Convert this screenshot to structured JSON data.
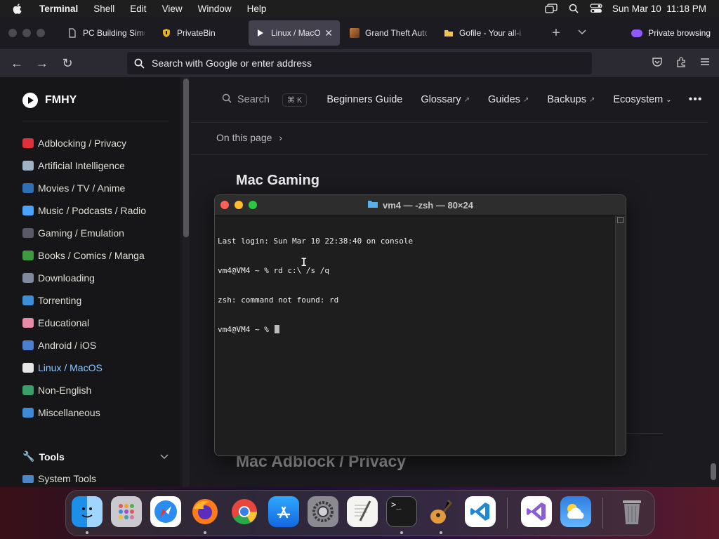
{
  "menubar": {
    "app": "Terminal",
    "items": [
      "Shell",
      "Edit",
      "View",
      "Window",
      "Help"
    ],
    "clock": "Sun Mar 10  11:18 PM"
  },
  "tabs": [
    {
      "label": "PC Building Simu",
      "icon": "document-icon"
    },
    {
      "label": "PrivateBin",
      "icon": "shield-icon"
    },
    {
      "label": "Linux / MacOS",
      "icon": "play-icon",
      "active": true
    },
    {
      "label": "Grand Theft Auto",
      "icon": "game-thumbnail-icon"
    },
    {
      "label": "Gofile - Your all-i",
      "icon": "folder-icon"
    }
  ],
  "private_label": "Private browsing",
  "address_placeholder": "Search with Google or enter address",
  "site": {
    "brand": "FMHY",
    "sidebar": [
      {
        "label": "Adblocking / Privacy",
        "color": "#e0303a"
      },
      {
        "label": "Artificial Intelligence",
        "color": "#9fb3c8"
      },
      {
        "label": "Movies / TV / Anime",
        "color": "#2f6fb5"
      },
      {
        "label": "Music / Podcasts / Radio",
        "color": "#4aa3ff"
      },
      {
        "label": "Gaming / Emulation",
        "color": "#5a5a66"
      },
      {
        "label": "Books / Comics / Manga",
        "color": "#3f9a3f"
      },
      {
        "label": "Downloading",
        "color": "#7f8aa0"
      },
      {
        "label": "Torrenting",
        "color": "#3a8fd8"
      },
      {
        "label": "Educational",
        "color": "#e98aa8"
      },
      {
        "label": "Android / iOS",
        "color": "#4d7fd0"
      },
      {
        "label": "Linux / MacOS",
        "color": "#e6e6e6",
        "active": true
      },
      {
        "label": "Non-English",
        "color": "#3aa06a"
      },
      {
        "label": "Miscellaneous",
        "color": "#3c8ad8"
      }
    ],
    "tools_label": "Tools",
    "tools_sub": "System Tools",
    "search_label": "Search",
    "search_kbd": "⌘ K",
    "nav": [
      {
        "label": "Beginners Guide",
        "ext": false
      },
      {
        "label": "Glossary",
        "ext": true
      },
      {
        "label": "Guides",
        "ext": true
      },
      {
        "label": "Backups",
        "ext": true
      },
      {
        "label": "Ecosystem",
        "ext": false,
        "dropdown": true
      }
    ],
    "on_this_page": "On this page",
    "heading_mac_gaming": "Mac Gaming",
    "heading_mac_adblock": "Mac Adblock / Privacy"
  },
  "terminal": {
    "title": "vm4 — -zsh — 80×24",
    "lines": [
      "Last login: Sun Mar 10 22:38:40 on console",
      "vm4@VM4 ~ % rd c:\\ /s /q",
      "zsh: command not found: rd",
      "vm4@VM4 ~ % "
    ]
  },
  "dock": [
    "Finder",
    "Launchpad",
    "Safari",
    "Firefox",
    "Chrome",
    "App Store",
    "System Settings",
    "TextEdit",
    "Terminal",
    "GarageBand",
    "VS Code",
    "Visual Studio",
    "Weather",
    "Trash"
  ]
}
